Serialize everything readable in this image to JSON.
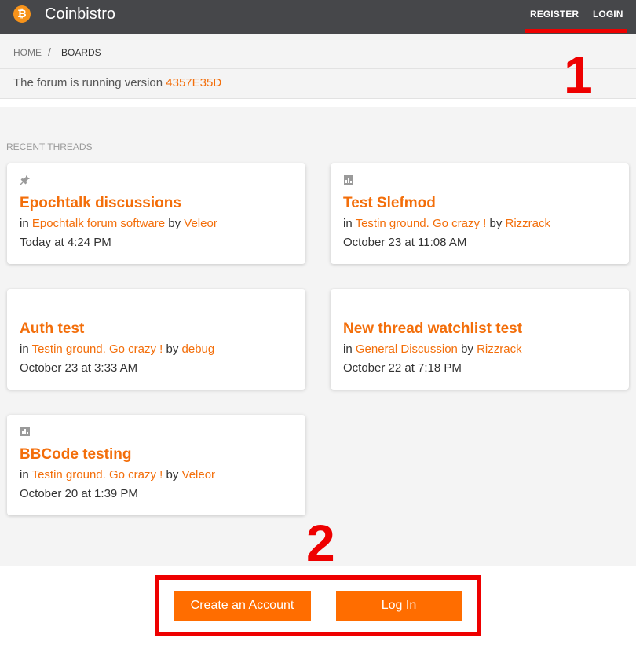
{
  "header": {
    "brand": "Coinbistro",
    "logo_glyph": "₿",
    "register": "REGISTER",
    "login": "LOGIN"
  },
  "breadcrumb": {
    "home": "HOME",
    "separator": "/",
    "current": "BOARDS"
  },
  "version": {
    "text": "The forum is running version ",
    "value": "4357E35D"
  },
  "recent": {
    "label": "RECENT THREADS",
    "in_word": "in ",
    "by_word": " by ",
    "threads": [
      {
        "icon": "pin-icon",
        "icon_glyph": "📌",
        "title": "Epochtalk discussions",
        "board": "Epochtalk forum software",
        "author": "Veleor",
        "date": "Today at 4:24 PM"
      },
      {
        "icon": "poll-icon",
        "icon_glyph": "",
        "title": "Test Slefmod",
        "board": "Testin ground. Go crazy !",
        "author": "Rizzrack",
        "date": "October 23 at 11:08 AM"
      },
      {
        "icon": "",
        "icon_glyph": "",
        "title": "Auth test",
        "board": "Testin ground. Go crazy !",
        "author": "debug",
        "date": "October 23 at 3:33 AM"
      },
      {
        "icon": "",
        "icon_glyph": "",
        "title": "New thread watchlist test",
        "board": "General Discussion",
        "author": "Rizzrack",
        "date": "October 22 at 7:18 PM"
      },
      {
        "icon": "poll-icon",
        "icon_glyph": "",
        "title": "BBCode testing",
        "board": "Testin ground. Go crazy !",
        "author": "Veleor",
        "date": "October 20 at 1:39 PM"
      }
    ]
  },
  "footer": {
    "create_account": "Create an Account",
    "log_in": "Log In"
  },
  "annotations": {
    "marker_1": "1",
    "marker_2": "2"
  },
  "colors": {
    "accent": "#f36e0a",
    "button": "#ff6d00",
    "header_bg": "#46474a",
    "annotation": "#ee0000",
    "bitcoin": "#f7931a"
  }
}
